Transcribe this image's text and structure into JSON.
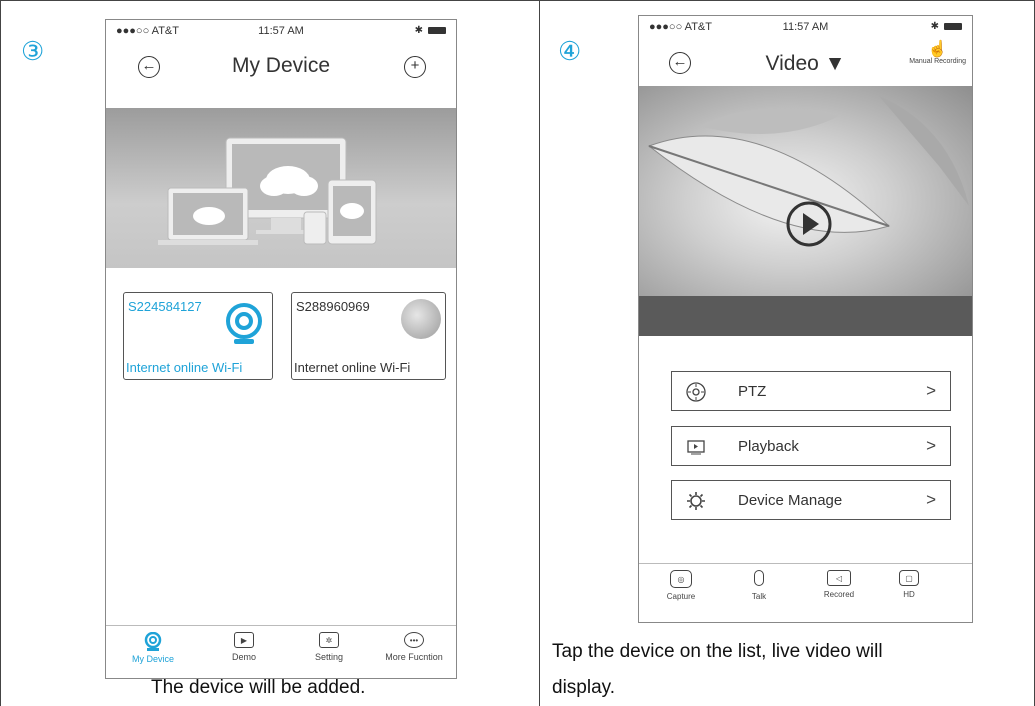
{
  "left": {
    "step": "③",
    "caption": "The device will be added.",
    "phone": {
      "carrier": "●●●○○ AT&T",
      "time": "11:57 AM",
      "title": "My Device",
      "devices": [
        {
          "id": "S224584127",
          "status": "Internet online Wi-Fi",
          "color": "#1fa3d8"
        },
        {
          "id": "S288960969",
          "status": "Internet online Wi-Fi",
          "color": "#333333"
        }
      ],
      "tabs": [
        "My Device",
        "Demo",
        "Setting",
        "More Fucntion"
      ]
    }
  },
  "right": {
    "step": "④",
    "caption_line1": "Tap the device on the list, live video will",
    "caption_line2": "display.",
    "phone": {
      "carrier": "●●●○○ AT&T",
      "time": "11:57 AM",
      "title": "Video ▼",
      "manual_recording": "Manual Recording",
      "menu": [
        "PTZ",
        "Playback",
        "Device Manage"
      ],
      "tabs": [
        "Capture",
        "Talk",
        "Recored",
        "HD"
      ]
    }
  },
  "colors": {
    "accent": "#1fa3d8"
  }
}
